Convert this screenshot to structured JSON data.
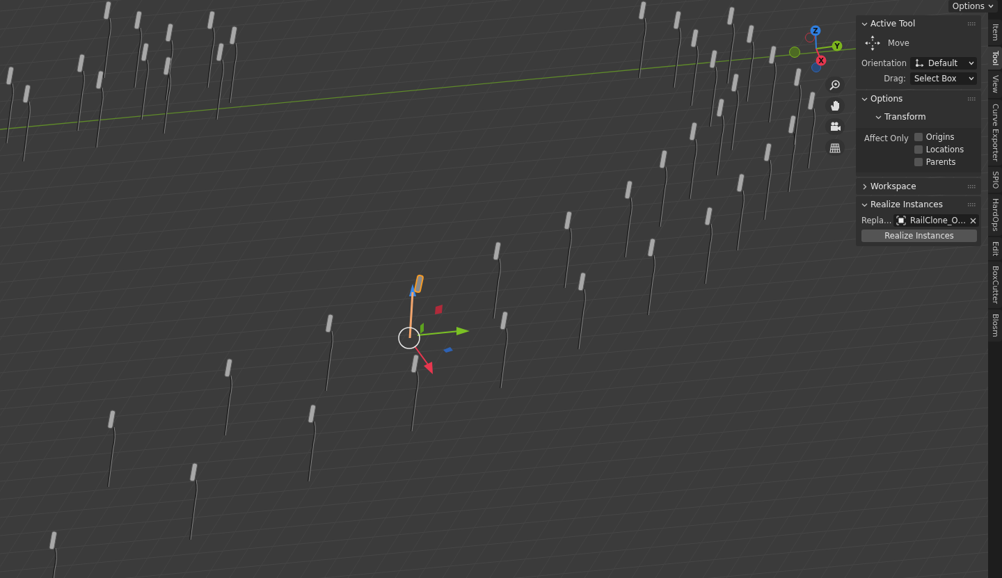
{
  "header": {
    "options_label": "Options"
  },
  "gizmo": {
    "axes": [
      {
        "label": "Z",
        "color": "#2f7fe0"
      },
      {
        "label": "Y",
        "color": "#7cb51e"
      },
      {
        "label": "X",
        "color": "#e8374f"
      }
    ]
  },
  "panels": [
    {
      "title": "Active Tool",
      "expanded": true,
      "rows": [
        {
          "kind": "tool",
          "label": "Move"
        },
        {
          "kind": "dropdown",
          "label": "Orientation",
          "value": "Default",
          "icon": true
        },
        {
          "kind": "dropdown",
          "label": "Drag:",
          "value": "Select Box",
          "icon": false
        }
      ]
    },
    {
      "title": "Options",
      "expanded": true,
      "rows": [
        {
          "kind": "subpanel",
          "title": "Transform",
          "expanded": true,
          "label": "Affect Only",
          "checks": [
            {
              "label": "Origins",
              "checked": false
            },
            {
              "label": "Locations",
              "checked": false
            },
            {
              "label": "Parents",
              "checked": false
            }
          ]
        }
      ]
    },
    {
      "title": "Workspace",
      "expanded": false
    },
    {
      "title": "Realize Instances",
      "expanded": true,
      "rows": [
        {
          "kind": "object_field",
          "label": "Repla…",
          "value": "RailClone_O…"
        },
        {
          "kind": "button",
          "label": "Realize Instances"
        }
      ]
    }
  ],
  "tabs": [
    {
      "label": "Item",
      "selected": false
    },
    {
      "label": "Tool",
      "selected": true
    },
    {
      "label": "View",
      "selected": false
    },
    {
      "label": "Curve Exporter",
      "selected": false
    },
    {
      "label": "SPIO",
      "selected": false
    },
    {
      "label": "HardOps",
      "selected": false
    },
    {
      "label": "Edit",
      "selected": false
    },
    {
      "label": "BoxCutter",
      "selected": false
    },
    {
      "label": "Blosm",
      "selected": false
    }
  ]
}
